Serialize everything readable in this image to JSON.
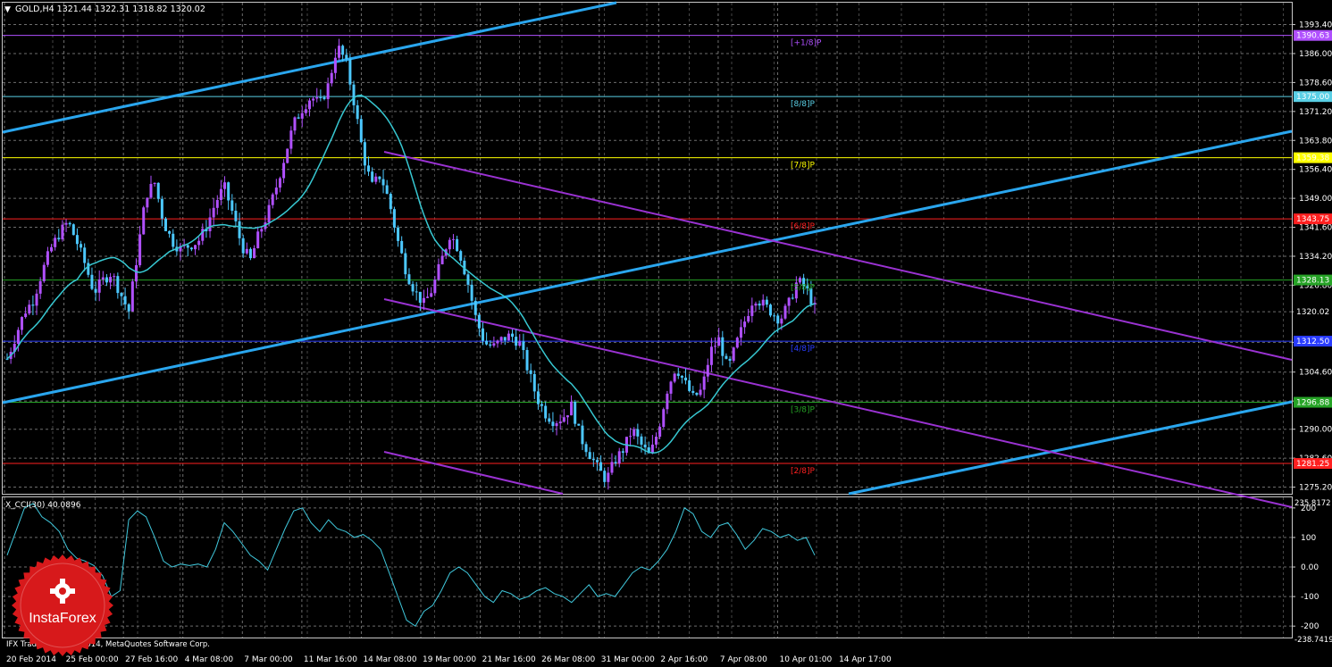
{
  "header": {
    "symbol_label": "GOLD,H4  1321.44 1322.31 1318.82 1320.02"
  },
  "indicator": {
    "label": "X_CCI(30) 40.0896",
    "axis_max_label": "235.8172",
    "axis_min_label": "-238.7419"
  },
  "footer": {
    "copyright": "IFX Trader, © 2001-2014, MetaQuotes Software Corp."
  },
  "logo": {
    "text": "InstaForex",
    "color": "#d7191b"
  },
  "colors": {
    "background": "#000000",
    "grid": "#c8c8c8",
    "bull_candle": "#b050ff",
    "bear_candle": "#4cc8ff",
    "moving_average": "#37c8d2",
    "trendline_blue": "#2aa6ee",
    "trendline_purple": "#9a32d2",
    "cci_line": "#40c8dc"
  },
  "chart_data": [
    {
      "type": "candlestick",
      "title": "GOLD,H4",
      "ohlc_current": {
        "open": 1321.44,
        "high": 1322.31,
        "low": 1318.82,
        "close": 1320.02
      },
      "y_ticks": [
        "1393.40",
        "1386.00",
        "1378.60",
        "1371.20",
        "1363.80",
        "1356.40",
        "1349.00",
        "1341.60",
        "1334.20",
        "1326.80",
        "1320.02",
        "1312.20",
        "1304.60",
        "1297.20",
        "1290.00",
        "1282.60",
        "1275.20"
      ],
      "ylim": [
        1273.5,
        1399.0
      ],
      "x_ticks": [
        "20 Feb 2014",
        "25 Feb 00:00",
        "27 Feb 16:00",
        "4 Mar 08:00",
        "7 Mar 00:00",
        "11 Mar 16:00",
        "14 Mar 08:00",
        "19 Mar 00:00",
        "21 Mar 16:00",
        "26 Mar 08:00",
        "31 Mar 00:00",
        "2 Apr 16:00",
        "7 Apr 08:00",
        "10 Apr 01:00",
        "14 Apr 17:00"
      ],
      "price_path": [
        1308,
        1314,
        1320,
        1323,
        1330,
        1336,
        1340,
        1343,
        1338,
        1332,
        1325,
        1328,
        1330,
        1325,
        1320,
        1335,
        1350,
        1353,
        1343,
        1338,
        1336,
        1337,
        1338,
        1342,
        1348,
        1352,
        1345,
        1337,
        1333,
        1340,
        1345,
        1352,
        1360,
        1368,
        1372,
        1375,
        1373,
        1378,
        1388,
        1384,
        1373,
        1360,
        1352,
        1355,
        1348,
        1338,
        1330,
        1325,
        1322,
        1326,
        1333,
        1340,
        1336,
        1328,
        1318,
        1312,
        1311,
        1313,
        1314,
        1312,
        1305,
        1298,
        1294,
        1292,
        1293,
        1296,
        1288,
        1284,
        1280,
        1277,
        1282,
        1285,
        1290,
        1286,
        1283,
        1290,
        1300,
        1306,
        1302,
        1298,
        1300,
        1310,
        1313,
        1305,
        1312,
        1318,
        1324,
        1322,
        1320,
        1318,
        1322,
        1328,
        1326,
        1321
      ],
      "murrey_levels": [
        {
          "label": "[+1/8]P",
          "value": "1390.63",
          "color": "#b050ff"
        },
        {
          "label": "[8/8]P",
          "value": "1375.00",
          "color": "#5ad0e6"
        },
        {
          "label": "[7/8]P",
          "value": "1359.38",
          "color": "#ffff00"
        },
        {
          "label": "[6/8]P",
          "value": "1343.75",
          "color": "#ff2020"
        },
        {
          "label": "[5/8]P",
          "value": "1328.13",
          "color": "#26a326"
        },
        {
          "label": "[4/8]P",
          "value": "1312.50",
          "color": "#2a3cff"
        },
        {
          "label": "[3/8]P",
          "value": "1296.88",
          "color": "#26a326"
        },
        {
          "label": "[2/8]P",
          "value": "1281.25",
          "color": "#ff2020"
        }
      ]
    },
    {
      "type": "line",
      "title": "X_CCI(30) 40.0896",
      "y_ticks": [
        "200",
        "100",
        "0.00",
        "-100",
        "-200"
      ],
      "ylim": [
        -238.7419,
        235.8172
      ],
      "values": [
        40,
        120,
        200,
        215,
        170,
        150,
        120,
        60,
        30,
        20,
        5,
        -30,
        -100,
        -80,
        160,
        190,
        170,
        100,
        20,
        0,
        10,
        5,
        10,
        0,
        60,
        150,
        120,
        80,
        40,
        20,
        -10,
        60,
        130,
        190,
        200,
        150,
        120,
        160,
        130,
        120,
        100,
        110,
        90,
        60,
        -20,
        -100,
        -180,
        -200,
        -150,
        -130,
        -80,
        -20,
        0,
        -20,
        -60,
        -100,
        -120,
        -80,
        -90,
        -110,
        -100,
        -80,
        -70,
        -90,
        -100,
        -120,
        -90,
        -60,
        -100,
        -90,
        -100,
        -60,
        -20,
        0,
        -10,
        20,
        60,
        120,
        200,
        180,
        120,
        100,
        140,
        150,
        110,
        60,
        90,
        130,
        120,
        100,
        110,
        90,
        100,
        40
      ]
    }
  ]
}
